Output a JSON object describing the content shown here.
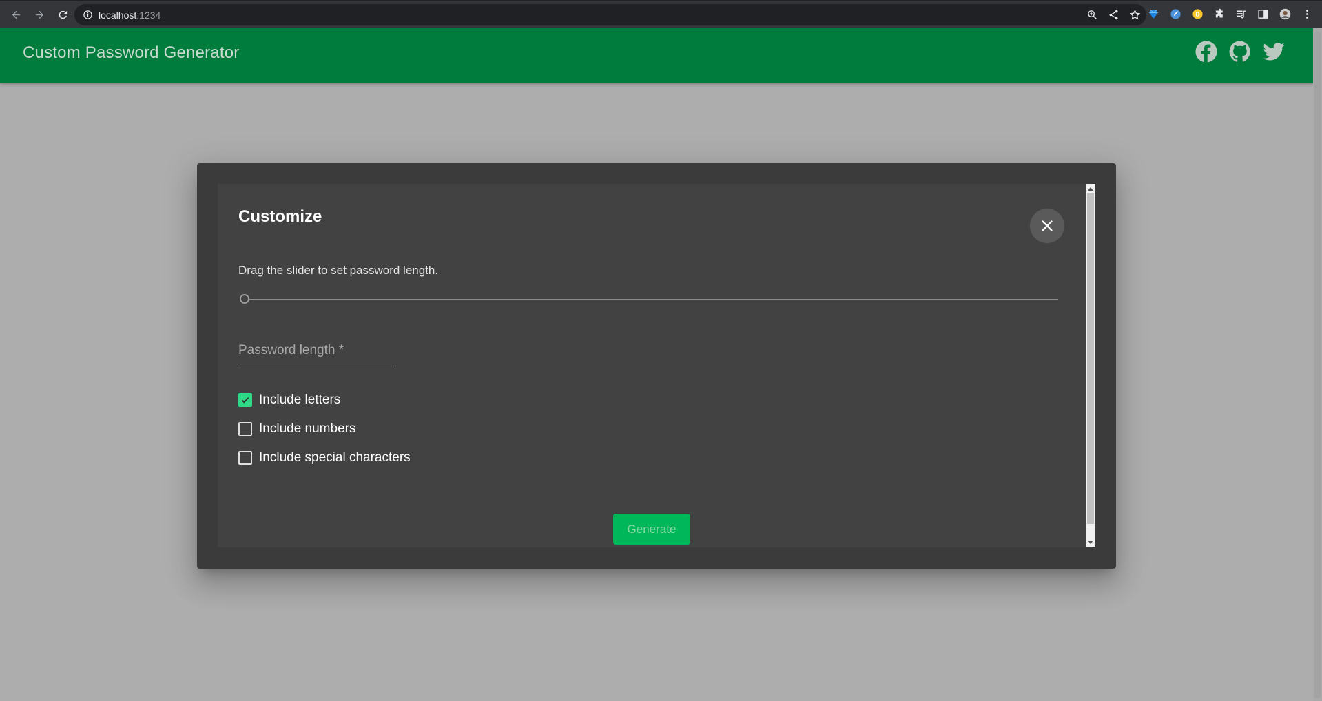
{
  "browser": {
    "url_host": "localhost",
    "url_port": ":1234",
    "icons": [
      "back-icon",
      "forward-icon",
      "reload-icon",
      "info-icon",
      "zoom-icon",
      "share-icon",
      "star-icon",
      "extension-gem-icon",
      "extension-pen-icon",
      "extension-coin-icon",
      "puzzle-icon",
      "playlist-icon",
      "side-panel-icon",
      "profile-avatar-icon",
      "menu-dots-icon"
    ]
  },
  "appbar": {
    "title": "Custom Password Generator",
    "social_icons": [
      "facebook-icon",
      "github-icon",
      "twitter-icon"
    ],
    "background": "#007d3c"
  },
  "dialog": {
    "title": "Customize",
    "hint": "Drag the slider to set password length.",
    "slider_value": 0,
    "password_length": {
      "value": "",
      "placeholder": "Password length *"
    },
    "options": [
      {
        "label": "Include letters",
        "checked": true
      },
      {
        "label": "Include numbers",
        "checked": false
      },
      {
        "label": "Include special characters",
        "checked": false
      }
    ],
    "generate_label": "Generate",
    "accent": "#2fd985"
  }
}
